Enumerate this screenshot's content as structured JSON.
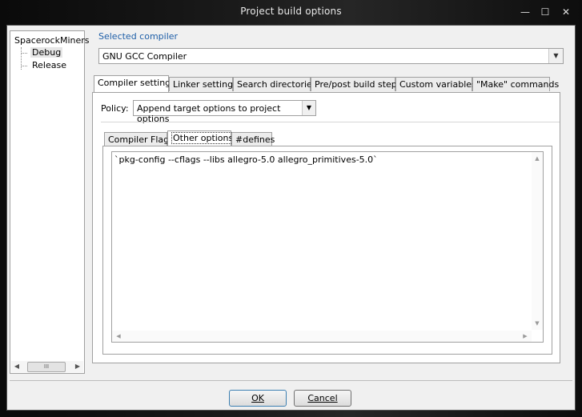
{
  "window": {
    "title": "Project build options",
    "min_glyph": "—",
    "max_glyph": "☐",
    "close_glyph": "✕"
  },
  "tree": {
    "root": "SpacerockMiners",
    "children": [
      "Debug",
      "Release"
    ],
    "selected": "Debug",
    "scroll_left": "◀",
    "scroll_right": "▶",
    "thumb_grip": "III"
  },
  "compiler": {
    "label": "Selected compiler",
    "value": "GNU GCC Compiler",
    "drop_glyph": "▼"
  },
  "tabs": [
    "Compiler settings",
    "Linker settings",
    "Search directories",
    "Pre/post build steps",
    "Custom variables",
    "\"Make\" commands"
  ],
  "active_tab": "Compiler settings",
  "policy": {
    "label": "Policy:",
    "value": "Append target options to project options",
    "drop_glyph": "▼"
  },
  "subtabs": [
    "Compiler Flags",
    "Other options",
    "#defines"
  ],
  "active_subtab": "Other options",
  "editor": {
    "text": "`pkg-config --cflags --libs allegro-5.0 allegro_primitives-5.0`",
    "up": "▲",
    "down": "▼",
    "left": "◀",
    "right": "▶"
  },
  "buttons": {
    "ok": "OK",
    "cancel": "Cancel"
  }
}
